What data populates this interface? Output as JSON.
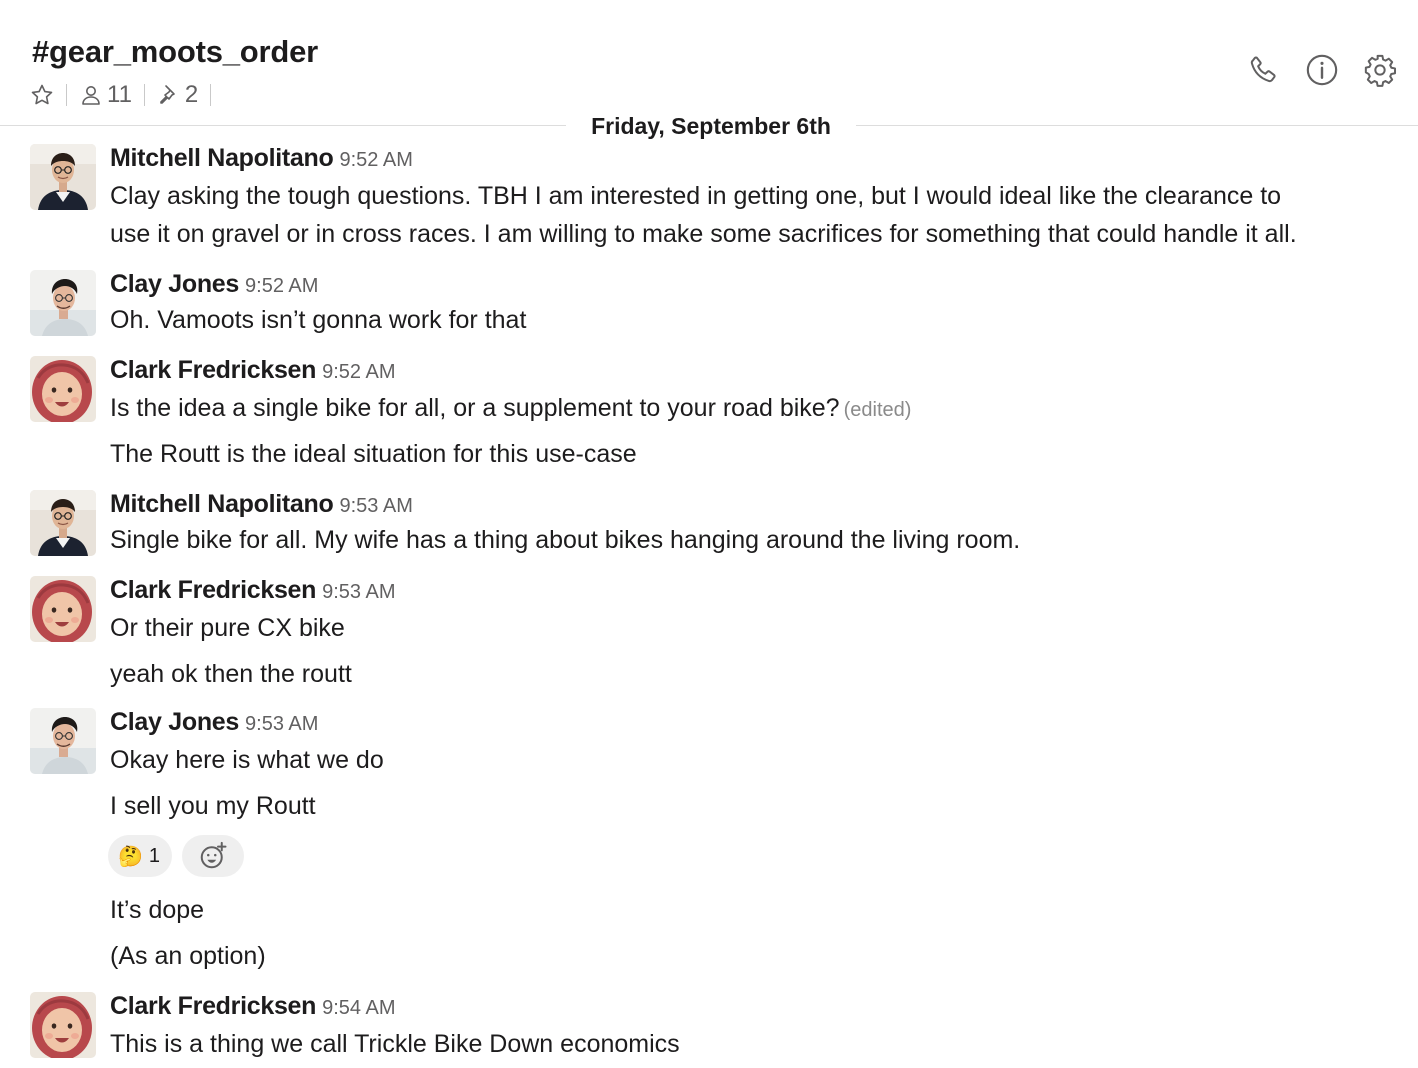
{
  "channel": {
    "name": "#gear_moots_order",
    "member_count": "11",
    "pinned_count": "2"
  },
  "header_actions": [
    "phone-icon",
    "info-icon",
    "gear-icon"
  ],
  "date_divider": "Friday, September 6th",
  "messages": [
    {
      "sender": "Mitchell Napolitano",
      "time": "9:52 AM",
      "lines": [
        "Clay asking the tough questions. TBH I am interested in getting one, but I would ideal like the clearance to",
        "use it on gravel or in cross races. I am willing to make some sacrifices for something that could handle it all."
      ]
    },
    {
      "sender": "Clay Jones",
      "time": "9:52 AM",
      "lines": [
        "Oh. Vamoots isn’t gonna work for that"
      ]
    },
    {
      "sender": "Clark Fredricksen",
      "time": "9:52 AM",
      "lines": [
        "Is the idea a single bike for all, or a supplement to your road bike?",
        "The Routt is the ideal situation for this use-case"
      ],
      "edited_label": "(edited)"
    },
    {
      "sender": "Mitchell Napolitano",
      "time": "9:53 AM",
      "lines": [
        "Single bike for all. My wife has a thing about bikes hanging around the living room."
      ]
    },
    {
      "sender": "Clark Fredricksen",
      "time": "9:53 AM",
      "lines": [
        "Or their pure CX bike",
        "yeah ok then the routt"
      ]
    },
    {
      "sender": "Clay Jones",
      "time": "9:53 AM",
      "lines": [
        "Okay here is what we do",
        "I sell you my Routt",
        "It’s dope",
        "(As an option)"
      ],
      "reaction": {
        "emoji": "🤔",
        "count": "1"
      }
    },
    {
      "sender": "Clark Fredricksen",
      "time": "9:54 AM",
      "lines": [
        "This is a thing we call Trickle Bike Down economics"
      ]
    }
  ],
  "colors": {
    "text": "#1d1c1d",
    "muted": "#616061",
    "divider": "#dddddd",
    "reaction_bg": "#efefef"
  }
}
